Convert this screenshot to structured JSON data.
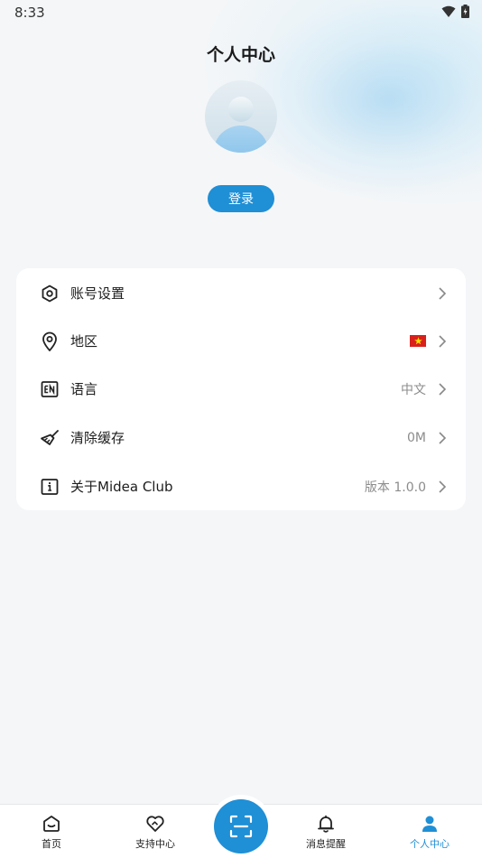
{
  "status_bar": {
    "time": "8:33"
  },
  "header": {
    "title": "个人中心"
  },
  "profile": {
    "login_label": "登录"
  },
  "menu": {
    "items": [
      {
        "label": "账号设置",
        "value": "",
        "icon": "settings-hex-icon"
      },
      {
        "label": "地区",
        "value": "",
        "icon": "location-pin-icon",
        "flag": "vietnam-flag"
      },
      {
        "label": "语言",
        "value": "中文",
        "icon": "language-en-icon"
      },
      {
        "label": "清除缓存",
        "value": "0M",
        "icon": "broom-icon"
      },
      {
        "label": "关于Midea Club",
        "value": "版本 1.0.0",
        "icon": "info-icon"
      }
    ]
  },
  "tabbar": {
    "tabs": [
      {
        "label": "首页",
        "icon": "home-icon"
      },
      {
        "label": "支持中心",
        "icon": "support-heart-icon"
      },
      {
        "label": "",
        "icon": "scan-icon"
      },
      {
        "label": "消息提醒",
        "icon": "bell-icon"
      },
      {
        "label": "个人中心",
        "icon": "person-icon",
        "active": true
      }
    ]
  },
  "colors": {
    "accent": "#1f8fd6",
    "background": "#f4f6f8",
    "card": "#ffffff",
    "flag_red": "#d9201b",
    "flag_star": "#ffde00"
  }
}
